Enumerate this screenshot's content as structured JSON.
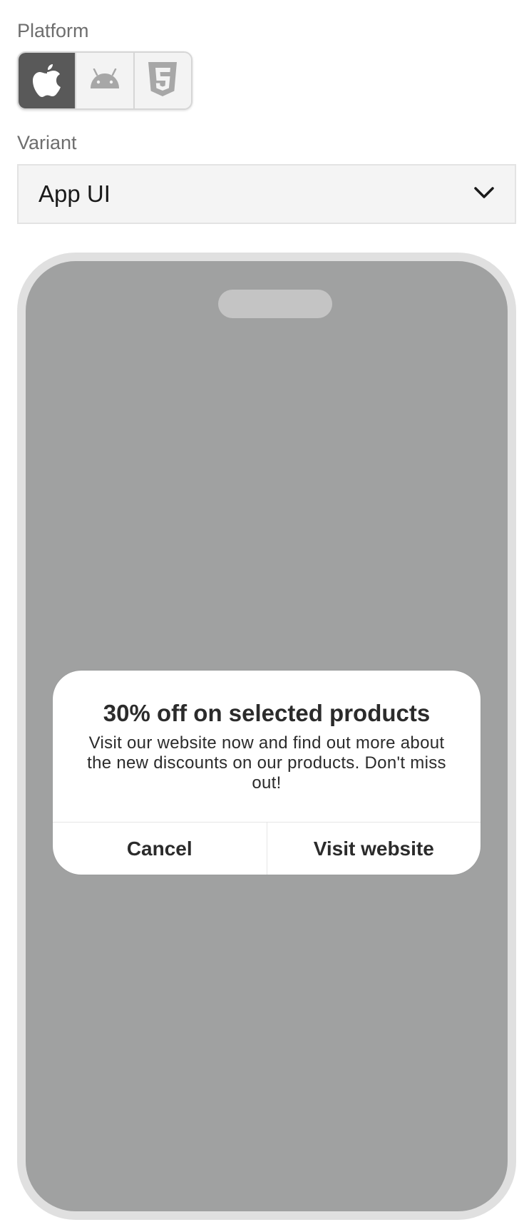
{
  "platform": {
    "label": "Platform",
    "options": [
      {
        "icon": "apple-icon",
        "selected": true
      },
      {
        "icon": "android-icon",
        "selected": false
      },
      {
        "icon": "html5-icon",
        "selected": false
      }
    ]
  },
  "variant": {
    "label": "Variant",
    "value": "App UI",
    "icon": "chevron-down-icon"
  },
  "alert": {
    "title": "30% off on selected products",
    "message": "Visit our website now and find out more about the new discounts on our products. Don't miss out!",
    "cancel_label": "Cancel",
    "confirm_label": "Visit website"
  },
  "colors": {
    "selected_segment": "#595959",
    "screen_overlay": "#a0a1a1",
    "frame": "#e0e0e0"
  }
}
